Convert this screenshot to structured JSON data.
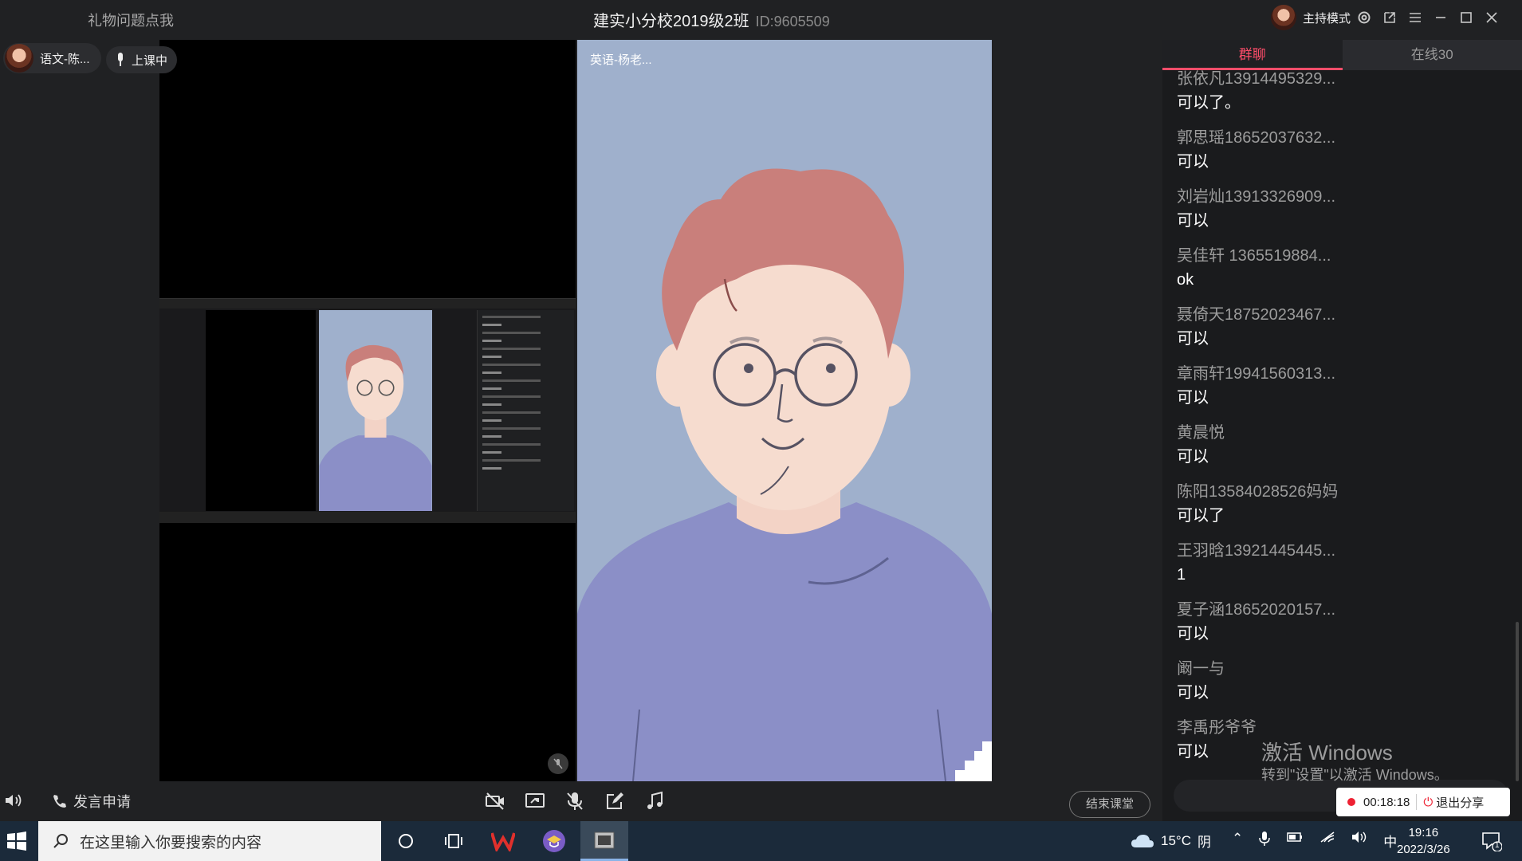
{
  "header": {
    "gift_link": "礼物问题点我",
    "class_title": "建实小分校2019级2班",
    "class_id": "ID:9605509",
    "host_mode": "主持模式"
  },
  "teacher": {
    "name": "语文-陈...",
    "status": "上课中"
  },
  "video": {
    "big_label": "英语-杨老..."
  },
  "chat": {
    "tabs": [
      "群聊",
      "在线30"
    ],
    "messages": [
      {
        "name": "张依凡13914495329...",
        "text": "可以了。"
      },
      {
        "name": "郭思瑶18652037632...",
        "text": "可以"
      },
      {
        "name": "刘岩灿13913326909...",
        "text": "可以"
      },
      {
        "name": "吴佳轩 1365519884...",
        "text": "ok"
      },
      {
        "name": "聂倚天18752023467...",
        "text": "可以"
      },
      {
        "name": "章雨轩19941560313...",
        "text": "可以"
      },
      {
        "name": "黄晨悦",
        "text": "可以"
      },
      {
        "name": "陈阳13584028526妈妈",
        "text": "可以了"
      },
      {
        "name": "王羽晗13921445445...",
        "text": "1"
      },
      {
        "name": "夏子涵18652020157...",
        "text": "可以"
      },
      {
        "name": "阚一与",
        "text": "可以"
      },
      {
        "name": "李禹彤爷爷",
        "text": "可以"
      }
    ]
  },
  "watermark": {
    "line1": "激活 Windows",
    "line2": "转到\"设置\"以激活 Windows。"
  },
  "bottom": {
    "raise_hand": "发言申请",
    "end_class": "结束课堂",
    "rec_time": "00:18:18",
    "exit_share": "退出分享"
  },
  "taskbar": {
    "search_placeholder": "在这里输入你要搜索的内容",
    "weather_temp": "15°C",
    "weather_text": "阴",
    "ime": "中",
    "time": "19:16",
    "date": "2022/3/26",
    "notif_count": "1"
  }
}
